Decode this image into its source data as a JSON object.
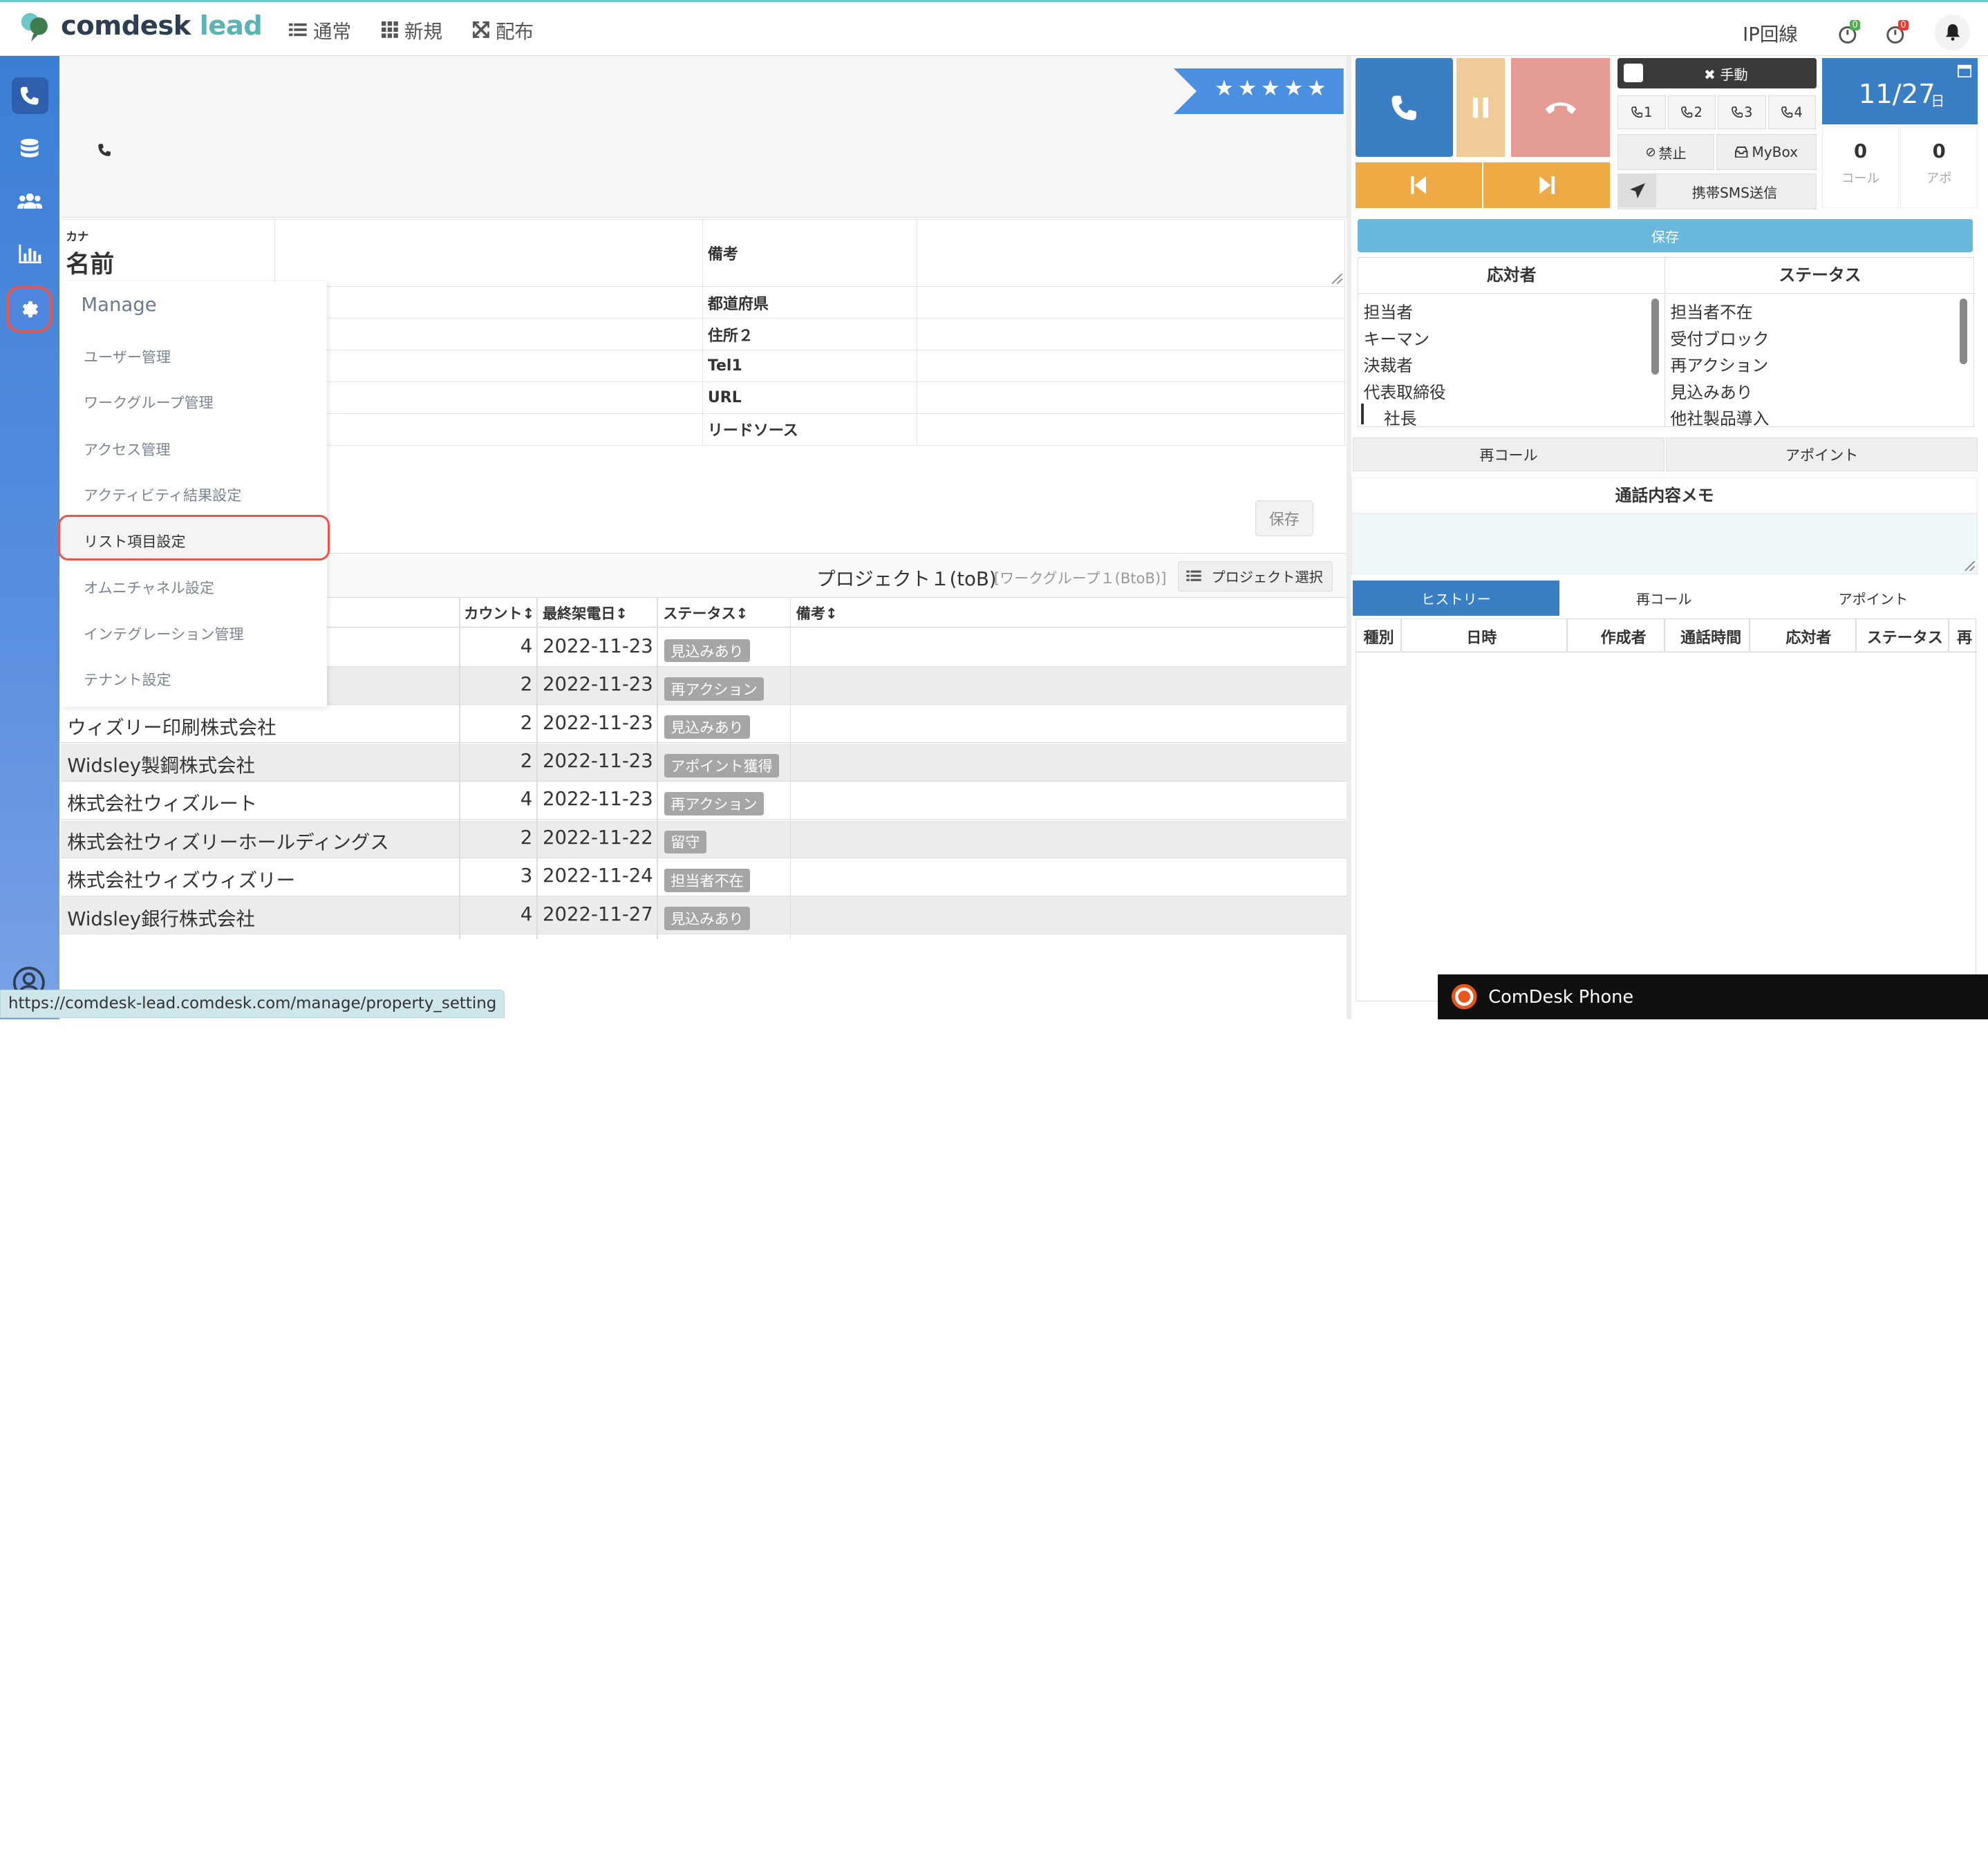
{
  "app": {
    "logo_comdesk": "comdesk",
    "logo_lead": "lead"
  },
  "topnav": [
    {
      "icon": "list-icon",
      "label": "通常"
    },
    {
      "icon": "grid-icon",
      "label": "新規"
    },
    {
      "icon": "expand-icon",
      "label": "配布"
    }
  ],
  "topright": {
    "ip_label": "IP回線",
    "badge1": "0",
    "badge2": "0"
  },
  "sidebar": [
    {
      "icon": "phone-icon"
    },
    {
      "icon": "database-icon"
    },
    {
      "icon": "users-icon"
    },
    {
      "icon": "chart-icon"
    },
    {
      "icon": "gear-icon",
      "selected": true
    }
  ],
  "record": {
    "stars": "★★★★★"
  },
  "props": {
    "kana": "カナ",
    "name": "名前",
    "labels": [
      "備考",
      "都道府県",
      "住所２",
      "Tel1",
      "URL",
      "リードソース"
    ]
  },
  "menu": {
    "header": "Manage",
    "items": [
      "ユーザー管理",
      "ワークグループ管理",
      "アクセス管理",
      "アクティビティ結果設定",
      "リスト項目設定",
      "オムニチャネル設定",
      "インテグレーション管理",
      "テナント設定"
    ],
    "highlighted": "リスト項目設定"
  },
  "form": {
    "save": "保存"
  },
  "project": {
    "title": "プロジェクト１(toB)",
    "workgroup": "[ワークグループ１(BtoB)]",
    "select_label": "プロジェクト選択"
  },
  "grid": {
    "headers": [
      "カウント",
      "最終架電日",
      "ステータス",
      "備考"
    ],
    "rows": [
      {
        "name": "",
        "count": "4",
        "date": "2022-11-23",
        "status": "見込みあり"
      },
      {
        "name": "",
        "count": "2",
        "date": "2022-11-23",
        "status": "再アクション"
      },
      {
        "name": "ウィズリー印刷株式会社",
        "count": "2",
        "date": "2022-11-23",
        "status": "見込みあり"
      },
      {
        "name": "Widsley製鋼株式会社",
        "count": "2",
        "date": "2022-11-23",
        "status": "アポイント獲得"
      },
      {
        "name": "株式会社ウィズルート",
        "count": "4",
        "date": "2022-11-23",
        "status": "再アクション"
      },
      {
        "name": "株式会社ウィズリーホールディングス",
        "count": "2",
        "date": "2022-11-22",
        "status": "留守"
      },
      {
        "name": "株式会社ウィズウィズリー",
        "count": "3",
        "date": "2022-11-24",
        "status": "担当者不在"
      },
      {
        "name": "Widsley銀行株式会社",
        "count": "4",
        "date": "2022-11-27",
        "status": "見込みあり"
      }
    ]
  },
  "statusbar": {
    "url": "https://comdesk-lead.comdesk.com/manage/property_setting"
  },
  "phone": {
    "mode": "手動",
    "lines": [
      "1",
      "2",
      "3",
      "4"
    ],
    "prohibit": "禁止",
    "mybox": "MyBox",
    "sms": "携帯SMS送信",
    "date": "11/27",
    "date_suffix": "日",
    "calls_value": "0",
    "calls_label": "コール",
    "appts_value": "0",
    "appts_label": "アポ",
    "save": "保存",
    "responder_header": "応対者",
    "status_header": "ステータス",
    "responders": [
      "担当者",
      "キーマン",
      "決裁者",
      "代表取締役",
      "社長"
    ],
    "statuses": [
      "担当者不在",
      "受付ブロック",
      "再アクション",
      "見込みあり",
      "他社製品導入"
    ],
    "recall": "再コール",
    "appoint": "アポイント",
    "memo_title": "通話内容メモ",
    "tabs": [
      "ヒストリー",
      "再コール",
      "アポイント"
    ],
    "history_headers": [
      "種別",
      "日時",
      "作成者",
      "通話時間",
      "応対者",
      "ステータス",
      "再"
    ]
  },
  "phonebar": {
    "label": "ComDesk Phone"
  }
}
